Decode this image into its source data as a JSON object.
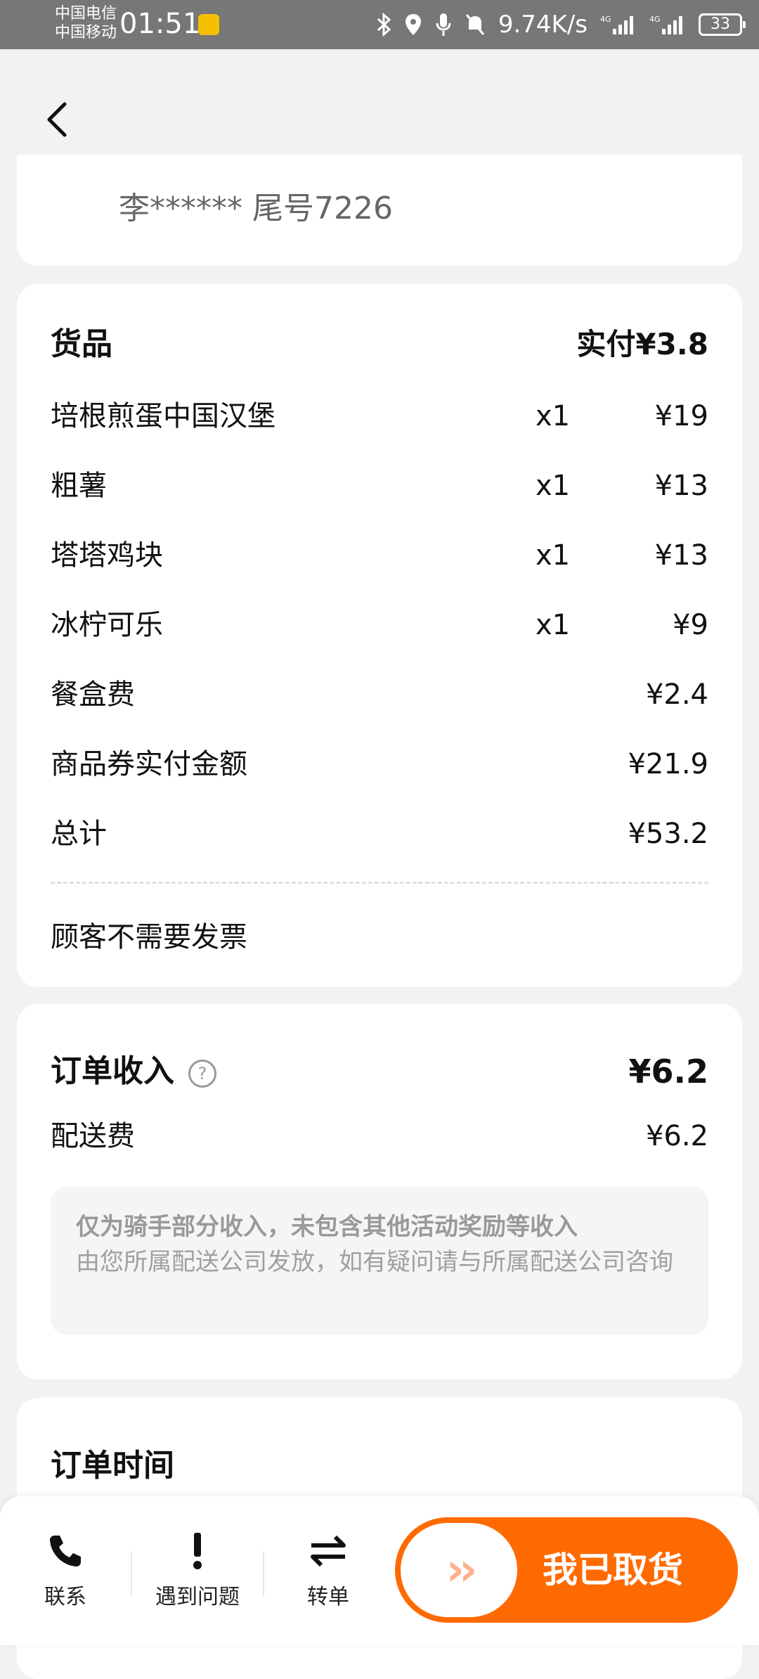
{
  "status_bar": {
    "carrier_1": "中国电信",
    "carrier_2": "中国移动",
    "time": "01:51",
    "net_speed": "9.74K/s",
    "battery": "33"
  },
  "customer": {
    "name": "李****** 尾号7226"
  },
  "goods": {
    "title": "货品",
    "paid": "实付¥3.8",
    "items": [
      {
        "name": "培根煎蛋中国汉堡",
        "qty": "x1",
        "price": "¥19"
      },
      {
        "name": "粗薯",
        "qty": "x1",
        "price": "¥13"
      },
      {
        "name": "塔塔鸡块",
        "qty": "x1",
        "price": "¥13"
      },
      {
        "name": "冰柠可乐",
        "qty": "x1",
        "price": "¥9"
      }
    ],
    "fees": [
      {
        "name": "餐盒费",
        "price": "¥2.4"
      },
      {
        "name": "商品券实付金额",
        "price": "¥21.9"
      },
      {
        "name": "总计",
        "price": "¥53.2"
      }
    ],
    "invoice_note": "顾客不需要发票"
  },
  "income": {
    "title": "订单收入",
    "help_icon": "?",
    "total": "¥6.2",
    "delivery_fee_label": "配送费",
    "delivery_fee": "¥6.2",
    "note_bold": "仅为骑手部分收入，未包含其他活动奖励等收入",
    "note_text": "由您所属配送公司发放，如有疑问请与所属配送公司咨询"
  },
  "order_time": {
    "title": "订单时间"
  },
  "bottom_bar": {
    "contact": "联系",
    "problem": "遇到问题",
    "transfer": "转单",
    "pickup_arrows": "››",
    "pickup": "我已取货"
  },
  "colors": {
    "accent": "#ff6a00"
  }
}
